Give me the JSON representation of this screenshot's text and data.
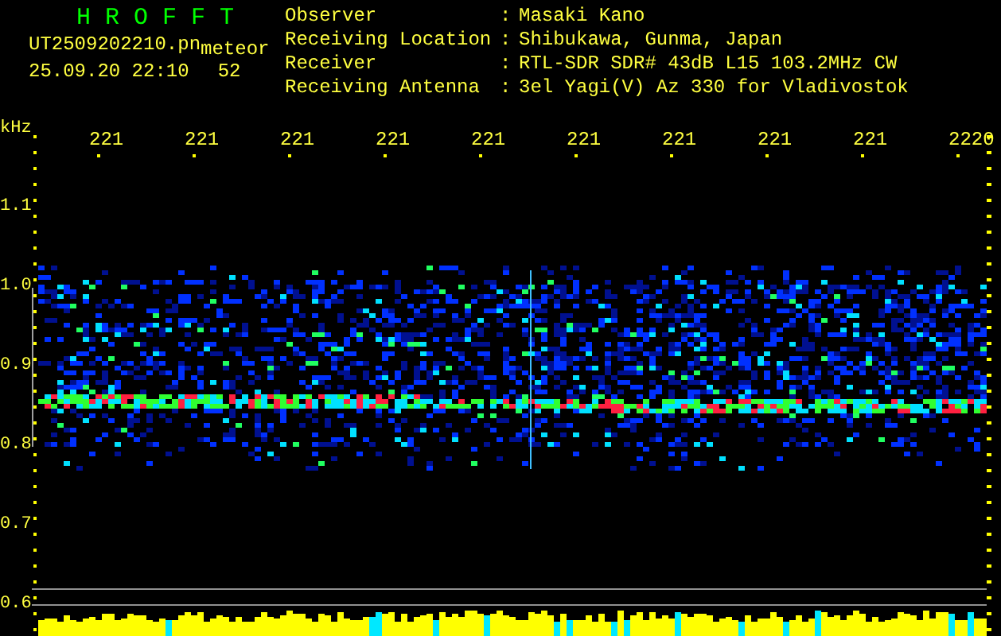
{
  "header": {
    "title": "H R O F F T",
    "file_name": "UT2509202210.pn",
    "tag": "meteor",
    "timestamp": "25.09.20 22:10",
    "count": "52"
  },
  "station_info": [
    {
      "label": "Observer",
      "separator": ":",
      "value": "Masaki Kano"
    },
    {
      "label": "Receiving Location",
      "separator": ":",
      "value": "Shibukawa, Gunma, Japan"
    },
    {
      "label": "Receiver",
      "separator": ":",
      "value": "RTL-SDR SDR# 43dB L15 103.2MHz CW"
    },
    {
      "label": "Receiving Antenna",
      "separator": ":",
      "value": "3el Yagi(V) Az 330 for Vladivostok"
    }
  ],
  "plot": {
    "unit": "kHz",
    "time_labels": [
      "221",
      "221",
      "221",
      "221",
      "221",
      "221",
      "221",
      "221",
      "221",
      "2220"
    ],
    "frequency_labels": [
      "1.1",
      "1.0",
      "0.9",
      "0.8",
      "0.7",
      "0.6"
    ]
  }
}
